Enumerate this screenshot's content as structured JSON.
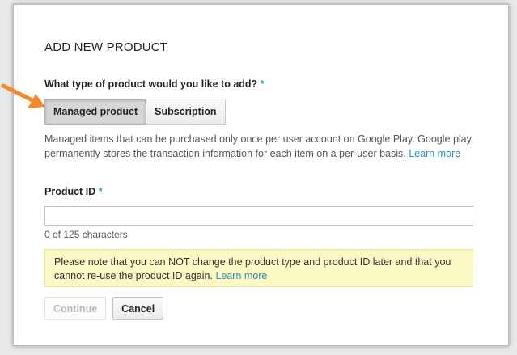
{
  "dialog": {
    "title": "ADD NEW PRODUCT",
    "question": "What type of product would you like to add?",
    "required_mark": "*",
    "product_types": [
      {
        "label": "Managed product",
        "selected": true
      },
      {
        "label": "Subscription",
        "selected": false
      }
    ],
    "description": "Managed items that can be purchased only once per user account on Google Play. Google play permanently stores the transaction information for each item on a per-user basis.",
    "description_link": "Learn more",
    "product_id_label": "Product ID",
    "product_id_value": "",
    "product_id_counter": "0 of 125 characters",
    "note_text": "Please note that you can NOT change the product type and product ID later and that you cannot re-use the product ID again.",
    "note_link": "Learn more",
    "continue_label": "Continue",
    "cancel_label": "Cancel"
  },
  "colors": {
    "link": "#2a8fbd",
    "arrow": "#f08a2c",
    "note_bg": "#fcf8c4"
  },
  "annotation": {
    "arrow_icon": "orange-arrow-icon"
  }
}
